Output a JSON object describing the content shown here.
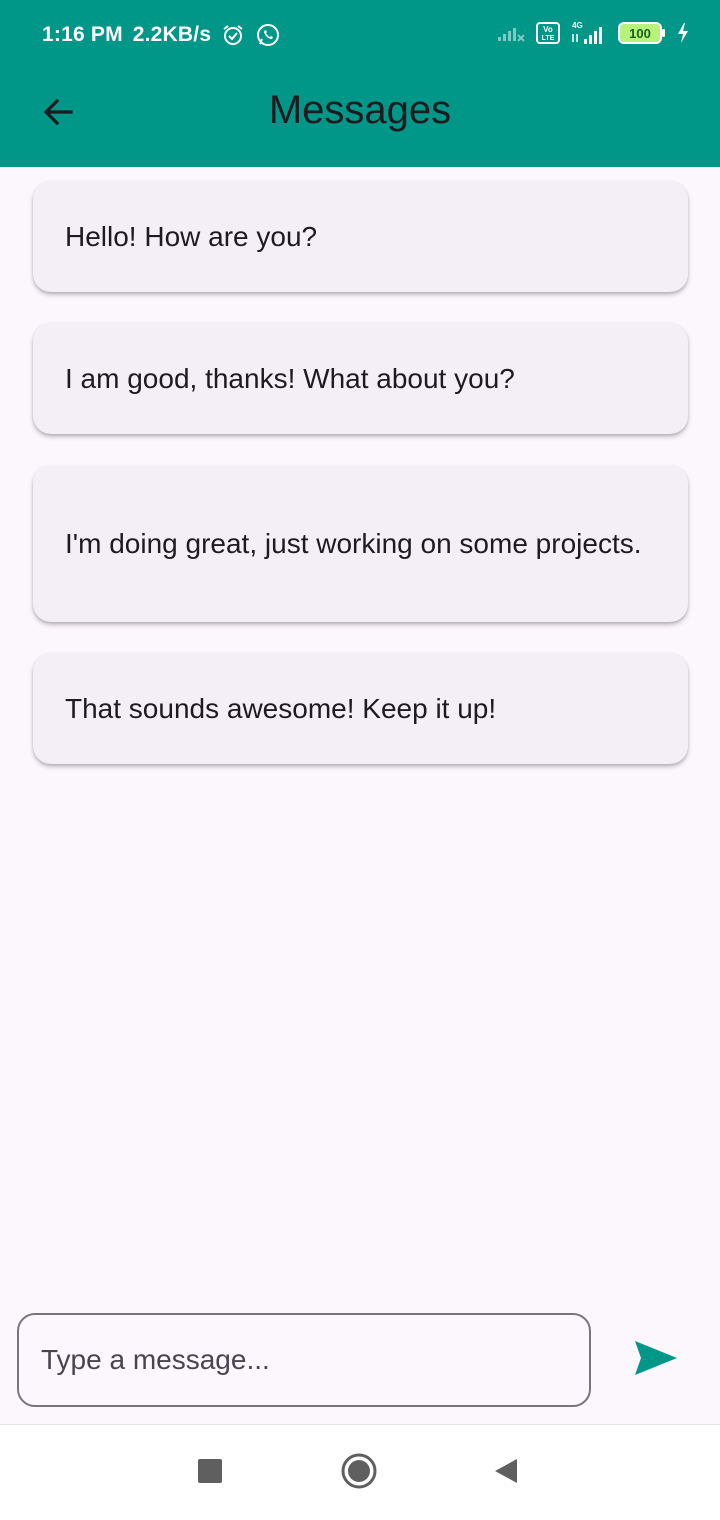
{
  "status_bar": {
    "time": "1:16 PM",
    "speed": "2.2KB/s",
    "icons": [
      "alarm-icon",
      "whatsapp-icon",
      "signal-x-icon",
      "volte-icon",
      "4g-signal-icon",
      "battery-icon",
      "charging-icon"
    ],
    "network_label": "4G",
    "volte_label": "Vo LTE",
    "battery": "100"
  },
  "app_bar": {
    "back_icon": "arrow-left-icon",
    "title": "Messages",
    "color": "#009688"
  },
  "messages": [
    "Hello! How are you?",
    "I am good, thanks! What about you?",
    "I'm doing great, just working on some projects.",
    "That sounds awesome! Keep it up!"
  ],
  "composer": {
    "placeholder": "Type a message...",
    "value": "",
    "send_icon": "send-icon",
    "send_color": "#009688"
  },
  "nav_bar": {
    "icons": [
      "square-icon",
      "circle-home-icon",
      "triangle-back-icon"
    ]
  }
}
